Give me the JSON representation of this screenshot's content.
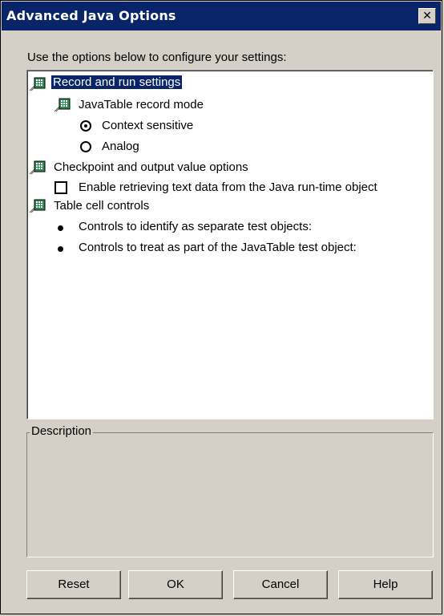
{
  "window": {
    "title": "Advanced Java Options",
    "close_glyph": "✕"
  },
  "intro_text": "Use the options below to configure your settings:",
  "tree": {
    "record_run": {
      "label": "Record and run settings",
      "icon": "settings-node-icon"
    },
    "javatable_mode": {
      "label": "JavaTable record mode",
      "icon": "settings-node-icon"
    },
    "context_sensitive": {
      "label": "Context sensitive",
      "selected": true
    },
    "analog": {
      "label": "Analog",
      "selected": false
    },
    "checkpoint": {
      "label": "Checkpoint and output value options",
      "icon": "settings-node-icon"
    },
    "enable_retrieving": {
      "label": "Enable retrieving text data from the Java run-time object",
      "checked": false
    },
    "table_cell": {
      "label": "Table cell controls",
      "icon": "settings-node-icon"
    },
    "separate_objects": {
      "label": "Controls to identify as separate test objects:"
    },
    "treat_as_part": {
      "label": "Controls to treat as part of the JavaTable test object:"
    }
  },
  "description": {
    "label": "Description",
    "text": ""
  },
  "buttons": {
    "reset": "Reset",
    "ok": "OK",
    "cancel": "Cancel",
    "help": "Help"
  }
}
